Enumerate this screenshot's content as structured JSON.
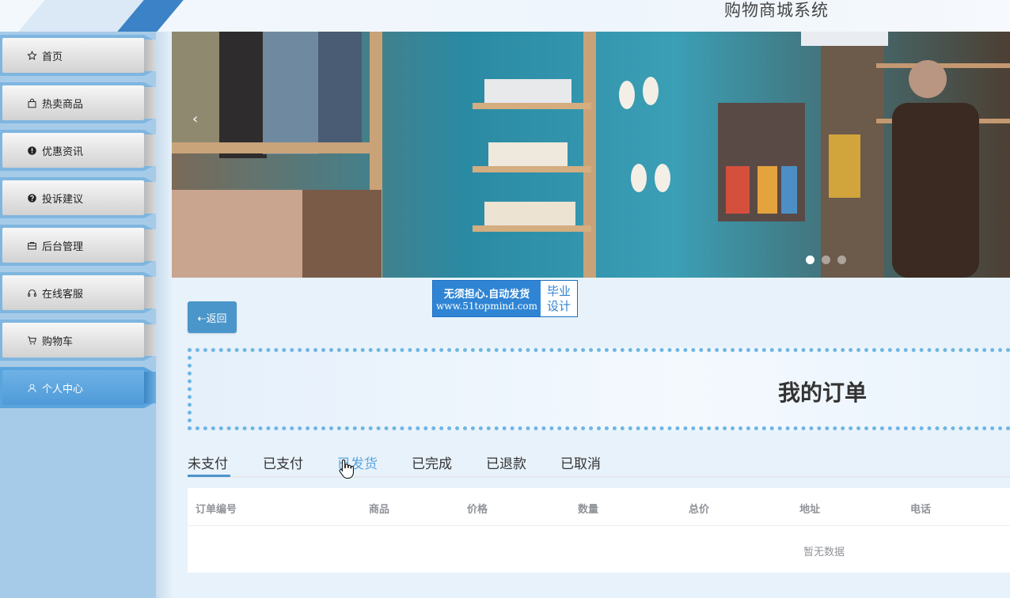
{
  "header": {
    "site_title": "购物商城系统"
  },
  "sidebar": {
    "items": [
      {
        "label": "首页",
        "icon": "star-icon",
        "active": false
      },
      {
        "label": "热卖商品",
        "icon": "bag-icon",
        "active": false
      },
      {
        "label": "优惠资讯",
        "icon": "alert-circle-icon",
        "active": false
      },
      {
        "label": "投诉建议",
        "icon": "question-circle-icon",
        "active": false
      },
      {
        "label": "后台管理",
        "icon": "briefcase-icon",
        "active": false
      },
      {
        "label": "在线客服",
        "icon": "headset-icon",
        "active": false
      },
      {
        "label": "购物车",
        "icon": "cart-icon",
        "active": false
      },
      {
        "label": "个人中心",
        "icon": "user-icon",
        "active": true
      }
    ]
  },
  "carousel": {
    "prev_arrow": "‹",
    "dot_count": 3,
    "active_dot": 0
  },
  "watermark": {
    "line1": "无须担心.自动发货",
    "line2": "www.51topmind.com",
    "right_line1": "毕业",
    "right_line2": "设计"
  },
  "back_button": {
    "label": "⇠返回"
  },
  "page": {
    "title": "我的订单"
  },
  "tabs": [
    {
      "label": "未支付",
      "active": true
    },
    {
      "label": "已支付",
      "active": false
    },
    {
      "label": "已发货",
      "active": false,
      "hovered": true
    },
    {
      "label": "已完成",
      "active": false
    },
    {
      "label": "已退款",
      "active": false
    },
    {
      "label": "已取消",
      "active": false
    }
  ],
  "table": {
    "columns": [
      "订单编号",
      "商品",
      "价格",
      "数量",
      "总价",
      "地址",
      "电话"
    ],
    "rows": [],
    "empty_text": "暂无数据"
  },
  "colors": {
    "accent": "#4a95c9",
    "sidebar_bg": "#a6cbe9",
    "active_nav": "#5aa4dd",
    "dotted_border": "#6fb6e3"
  }
}
